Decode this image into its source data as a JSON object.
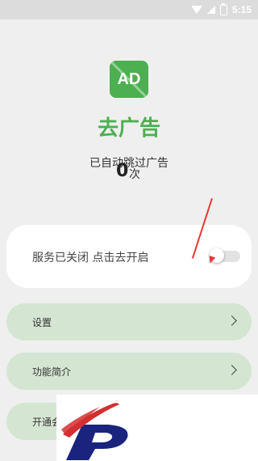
{
  "statusbar": {
    "time": "5:15"
  },
  "logo": {
    "text": "AD"
  },
  "app": {
    "title": "去广告"
  },
  "stats": {
    "skipped_label": "已自动跳过广告",
    "count": "0",
    "count_unit": "次"
  },
  "service": {
    "status_text": "服务已关闭 点击去开启",
    "enabled": false
  },
  "menu": {
    "items": [
      {
        "label": "设置"
      },
      {
        "label": "功能简介"
      },
      {
        "label": "开通会"
      }
    ]
  },
  "colors": {
    "accent": "#4caf50",
    "menu_bg": "#d4e6d2",
    "arrow": "#e53935"
  },
  "icons": [
    "wifi-icon",
    "signal-icon",
    "battery-icon",
    "chevron-right-icon",
    "red-arrow-icon",
    "brand-p-logo-icon"
  ]
}
